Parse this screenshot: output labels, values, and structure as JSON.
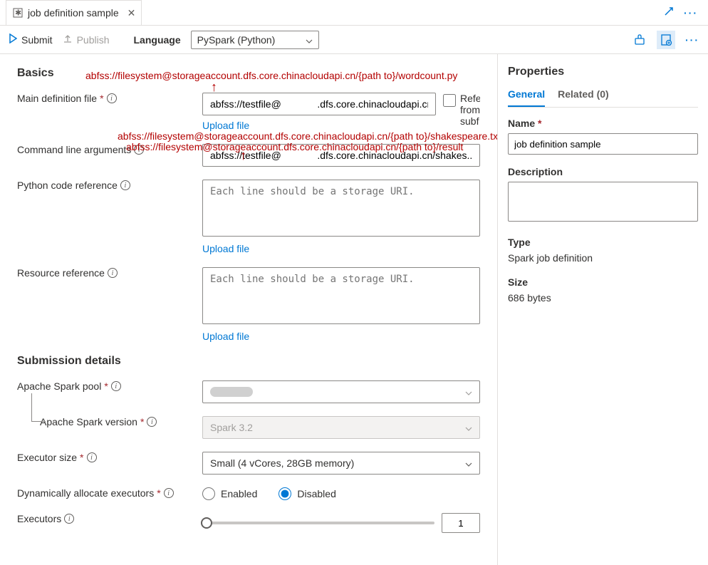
{
  "tab": {
    "title": "job definition sample"
  },
  "toolbar": {
    "submit": "Submit",
    "publish": "Publish",
    "lang_label": "Language",
    "lang_value": "PySpark (Python)"
  },
  "basics": {
    "title": "Basics",
    "main_def_label": "Main definition file",
    "main_def_value": "abfss://testfile@             .dfs.core.chinacloudapi.cn...",
    "reference_label": "Reference from subfolder",
    "upload_file": "Upload file",
    "cmd_args_label": "Command line arguments",
    "cmd_args_value": "abfss://testfile@             .dfs.core.chinacloudapi.cn/shakes...",
    "py_ref_label": "Python code reference",
    "py_ref_placeholder": "Each line should be a storage URI.",
    "res_ref_label": "Resource reference",
    "res_ref_placeholder": "Each line should be a storage URI."
  },
  "submission": {
    "title": "Submission details",
    "pool_label": "Apache Spark pool",
    "version_label": "Apache Spark version",
    "version_value": "Spark 3.2",
    "executor_size_label": "Executor size",
    "executor_size_value": "Small (4 vCores, 28GB memory)",
    "dyn_alloc_label": "Dynamically allocate executors",
    "enabled": "Enabled",
    "disabled": "Disabled",
    "executors_label": "Executors",
    "executors_value": "1"
  },
  "annotations": {
    "a1": "abfss://filesystem@storageaccount.dfs.core.chinacloudapi.cn/{path to}/wordcount.py",
    "a2": "abfss://filesystem@storageaccount.dfs.core.chinacloudapi.cn/{path to}/shakespeare.txt",
    "a3": "abfss://filesystem@storageaccount.dfs.core.chinacloudapi.cn/{path to}/result"
  },
  "properties": {
    "title": "Properties",
    "tab_general": "General",
    "tab_related": "Related (0)",
    "name_label": "Name",
    "name_value": "job definition sample",
    "desc_label": "Description",
    "type_label": "Type",
    "type_value": "Spark job definition",
    "size_label": "Size",
    "size_value": "686 bytes"
  }
}
